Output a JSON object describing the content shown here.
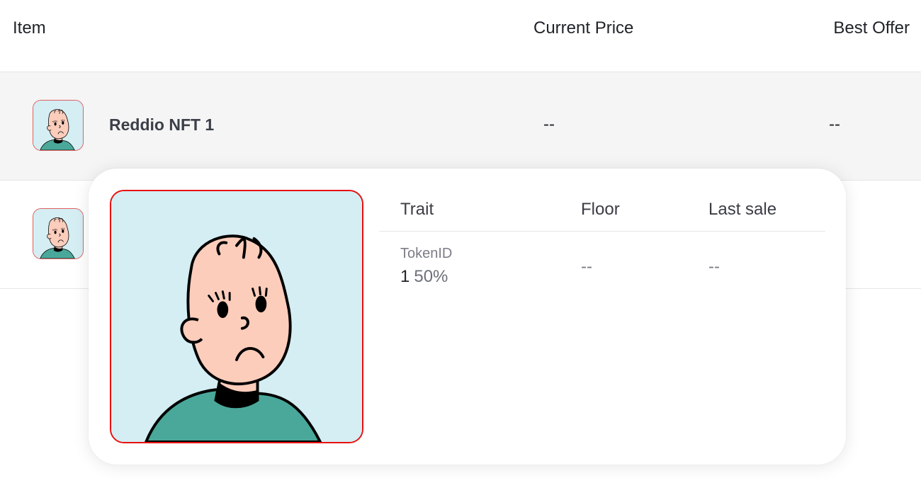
{
  "table": {
    "headers": {
      "item": "Item",
      "current_price": "Current Price",
      "best_offer": "Best Offer"
    },
    "rows": [
      {
        "name": "Reddio NFT 1",
        "current_price": "--",
        "best_offer": "--",
        "avatar_icon": "nft-avatar-icon"
      },
      {
        "name": "",
        "current_price": "",
        "best_offer": "",
        "avatar_icon": "nft-avatar-icon"
      }
    ]
  },
  "popup": {
    "image_icon": "nft-avatar-icon",
    "columns": {
      "trait": "Trait",
      "floor": "Floor",
      "last_sale": "Last sale"
    },
    "traits": [
      {
        "type": "TokenID",
        "value": "1",
        "percent": "50%",
        "floor": "--",
        "last_sale": "--"
      }
    ]
  },
  "colors": {
    "row_highlight": "#f5f5f5",
    "avatar_bg": "#d4eef3",
    "avatar_border": "#e81010",
    "shirt": "#4aa89a",
    "skin": "#fdcdbc"
  }
}
